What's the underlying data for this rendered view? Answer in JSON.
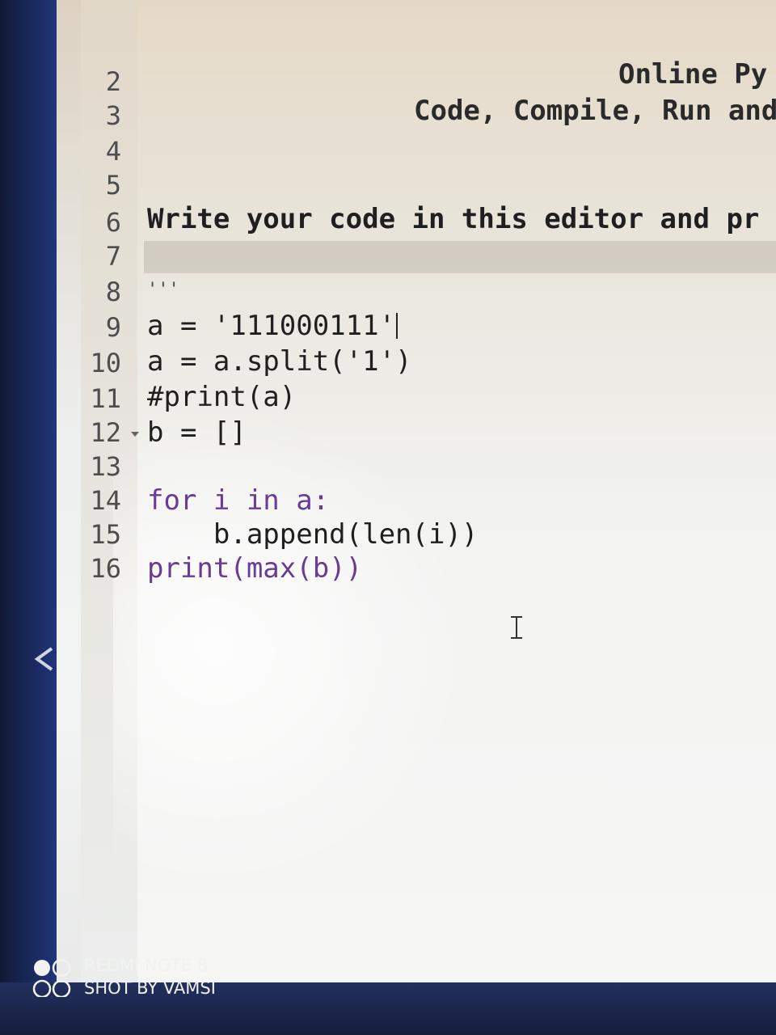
{
  "editor": {
    "header_line_3": "Online Py",
    "header_line_4": "Code, Compile, Run and",
    "lines": [
      {
        "number": "2",
        "text": ""
      },
      {
        "number": "3",
        "text": ""
      },
      {
        "number": "4",
        "text": ""
      },
      {
        "number": "5",
        "text": "Write your code in this editor and pr"
      },
      {
        "number": "6",
        "text": ""
      },
      {
        "number": "7",
        "text": "'''"
      },
      {
        "number": "8",
        "text": "a = '111000111'"
      },
      {
        "number": "9",
        "text": "a = a.split('1')"
      },
      {
        "number": "10",
        "text": "#print(a)"
      },
      {
        "number": "11",
        "text": "b = []"
      },
      {
        "number": "12",
        "text": ""
      },
      {
        "number": "13",
        "text": "for i in a:"
      },
      {
        "number": "14",
        "text": "    b.append(len(i))"
      },
      {
        "number": "15",
        "text": "print(max(b))"
      },
      {
        "number": "16",
        "text": ""
      }
    ],
    "active_line": "8",
    "fold_marker_line": "13"
  },
  "watermark": {
    "line1": "REDMI NOTE 8",
    "line2": "SHOT BY VAMSI"
  },
  "icons": [
    "fold-arrow-icon",
    "text-cursor-icon",
    "camera-dual-circle-icon",
    "chevron-left-icon"
  ],
  "colors": {
    "keyword": "#6a3b95",
    "text": "#1f1f1f",
    "line_number": "#4d4d4d",
    "bezel": "#1b2a55"
  }
}
